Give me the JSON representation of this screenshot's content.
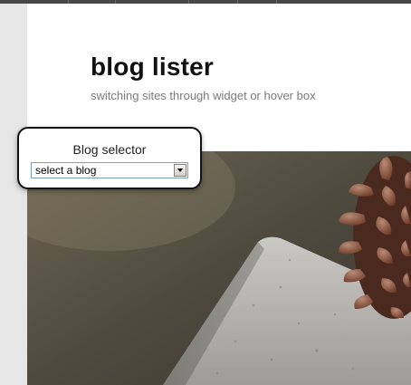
{
  "site": {
    "title": "blog lister",
    "tagline": "switching sites through widget or hover box"
  },
  "widget": {
    "title": "Blog selector",
    "select": {
      "selected": "select a blog"
    }
  },
  "icons": {
    "dropdown": "chevron-down-icon"
  },
  "colors": {
    "page_background": "#ffffff",
    "sidebar_gutter": "#e6e6e6",
    "top_bar": "#474747",
    "widget_border": "#111111"
  }
}
